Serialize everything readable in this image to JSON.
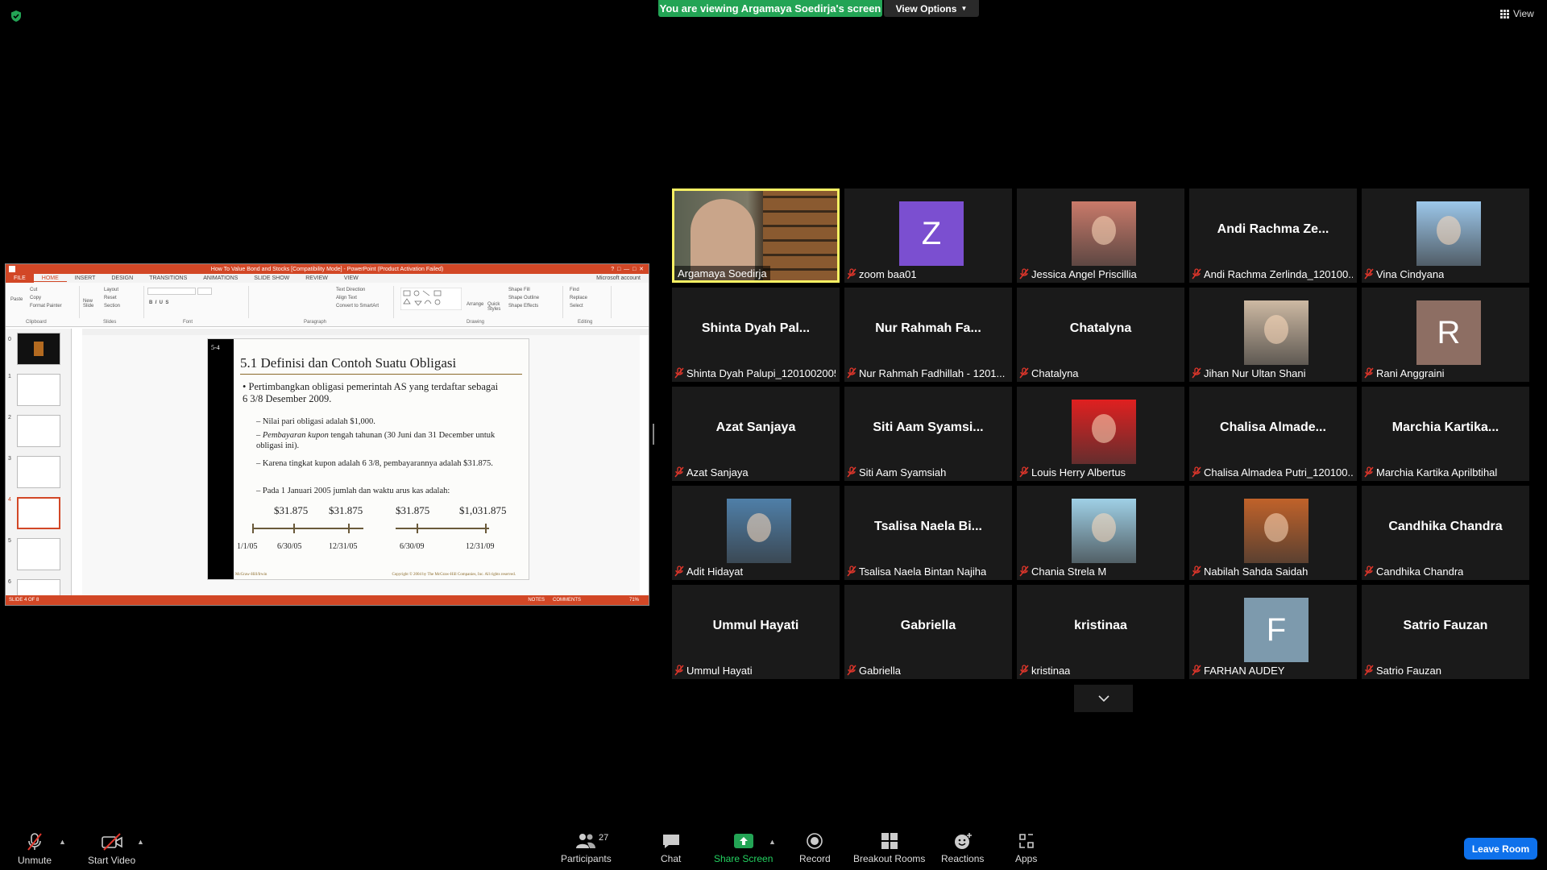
{
  "banner": {
    "viewing": "You are viewing Argamaya Soedirja's screen",
    "view_options": "View Options"
  },
  "top_right": {
    "view": "View"
  },
  "powerpoint": {
    "title": "How To Value Bond and Stocks [Compatibility Mode] - PowerPoint (Product Activation Failed)",
    "tabs": [
      "FILE",
      "HOME",
      "INSERT",
      "DESIGN",
      "TRANSITIONS",
      "ANIMATIONS",
      "SLIDE SHOW",
      "REVIEW",
      "VIEW"
    ],
    "account": "Microsoft account",
    "ribbon_groups": [
      "Clipboard",
      "Slides",
      "Font",
      "Paragraph",
      "Drawing",
      "Editing"
    ],
    "ribbon_items": {
      "paste": "Paste",
      "cut": "Cut",
      "copy": "Copy",
      "format_painter": "Format Painter",
      "new_slide": "New Slide",
      "layout": "Layout",
      "reset": "Reset",
      "section": "Section",
      "text_direction": "Text Direction",
      "align_text": "Align Text",
      "smartart": "Convert to SmartArt",
      "arrange": "Arrange",
      "quick_styles": "Quick Styles",
      "shape_fill": "Shape Fill",
      "shape_outline": "Shape Outline",
      "shape_effects": "Shape Effects",
      "find": "Find",
      "replace": "Replace",
      "select": "Select"
    },
    "thumbs": [
      "0",
      "1",
      "2",
      "3",
      "4",
      "5",
      "6"
    ],
    "slide": {
      "number": "5-4",
      "title": "5.1   Definisi dan Contoh Suatu Obligasi",
      "bullet": "Pertimbangkan obligasi pemerintah AS yang terdaftar sebagai 6 3/8 Desember 2009.",
      "sub1": "Nilai pari obligasi adalah $1,000.",
      "sub2_italic": "Pembayaran kupon",
      "sub2_rest": " tengah tahunan (30 Juni dan 31 December untuk obligasi ini).",
      "sub3": "Karena tingkat kupon adalah 6 3/8, pembayarannya adalah $31.875.",
      "sub4": "Pada 1 Januari 2005 jumlah dan waktu arus kas adalah:",
      "amounts": [
        "$31.875",
        "$31.875",
        "$31.875",
        "$1,031.875"
      ],
      "dates": [
        "1/1/05",
        "6/30/05",
        "12/31/05",
        "6/30/09",
        "12/31/09"
      ],
      "footer_left": "McGraw-Hill/Irwin",
      "footer_right": "Copyright © 2004 by The McGraw-Hill Companies, Inc. All rights reserved."
    },
    "status": {
      "slide": "SLIDE 4 OF 8",
      "notes": "NOTES",
      "comments": "COMMENTS",
      "zoom": "71%"
    }
  },
  "participants": [
    {
      "name": "Argamaya Soedirja",
      "label": "Argamaya Soedirja",
      "type": "video",
      "active": true
    },
    {
      "name": "zoom baa01",
      "label": "zoom baa01",
      "type": "letter",
      "letter": "Z",
      "color": "#7b4fd0"
    },
    {
      "name": "Jessica Angel Priscillia",
      "label": "Jessica Angel Priscillia",
      "type": "photo",
      "color": "#c97a6a"
    },
    {
      "name": "Andi Rachma Ze...",
      "label": "Andi Rachma Zerlinda_120100...",
      "type": "name"
    },
    {
      "name": "Vina Cindyana",
      "label": "Vina Cindyana",
      "type": "photo",
      "color": "#9cc7ea"
    },
    {
      "name": "Shinta Dyah Pal...",
      "label": "Shinta Dyah Palupi_1201002005",
      "type": "name"
    },
    {
      "name": "Nur Rahmah Fa...",
      "label": "Nur Rahmah Fadhillah - 1201...",
      "type": "name"
    },
    {
      "name": "Chatalyna",
      "label": "Chatalyna",
      "type": "name"
    },
    {
      "name": "Jihan Nur Ultan Shani",
      "label": "Jihan Nur Ultan Shani",
      "type": "photo",
      "color": "#cdb9a3"
    },
    {
      "name": "Rani Anggraini",
      "label": "Rani Anggraini",
      "type": "letter",
      "letter": "R",
      "color": "#8d6e63"
    },
    {
      "name": "Azat Sanjaya",
      "label": "Azat Sanjaya",
      "type": "name"
    },
    {
      "name": "Siti Aam Syamsi...",
      "label": "Siti Aam Syamsiah",
      "type": "name"
    },
    {
      "name": "Louis Herry Albertus",
      "label": "Louis Herry Albertus",
      "type": "photo",
      "color": "#e02020"
    },
    {
      "name": "Chalisa Almade...",
      "label": "Chalisa Almadea Putri_120100...",
      "type": "name"
    },
    {
      "name": "Marchia Kartika...",
      "label": "Marchia Kartika Aprilbtihal",
      "type": "name"
    },
    {
      "name": "Adit Hidayat",
      "label": "Adit Hidayat",
      "type": "photo",
      "color": "#4f7fa8"
    },
    {
      "name": "Tsalisa Naela Bi...",
      "label": "Tsalisa Naela Bintan Najiha",
      "type": "name"
    },
    {
      "name": "Chania Strela M",
      "label": "Chania Strela M",
      "type": "photo",
      "color": "#9fd0e6"
    },
    {
      "name": "Nabilah Sahda Saidah",
      "label": "Nabilah Sahda Saidah",
      "type": "photo",
      "color": "#c0622a"
    },
    {
      "name": "Candhika Chandra",
      "label": "Candhika Chandra",
      "type": "name"
    },
    {
      "name": "Ummul Hayati",
      "label": "Ummul Hayati",
      "type": "name"
    },
    {
      "name": "Gabriella",
      "label": "Gabriella",
      "type": "name"
    },
    {
      "name": "kristinaa",
      "label": "kristinaa",
      "type": "name"
    },
    {
      "name": "FARHAN AUDEY",
      "label": "FARHAN AUDEY",
      "type": "letter",
      "letter": "F",
      "color": "#7d9aad"
    },
    {
      "name": "Satrio Fauzan",
      "label": "Satrio Fauzan",
      "type": "name"
    }
  ],
  "toolbar": {
    "unmute": "Unmute",
    "start_video": "Start Video",
    "participants": "Participants",
    "participant_count": "27",
    "chat": "Chat",
    "share_screen": "Share Screen",
    "record": "Record",
    "breakout": "Breakout Rooms",
    "reactions": "Reactions",
    "apps": "Apps",
    "leave": "Leave Room"
  },
  "colors": {
    "accent_green": "#23a455",
    "leave_blue": "#0e71eb",
    "active_speaker": "#f7f063",
    "muted_red": "#e0362b",
    "powerpoint": "#d24726"
  }
}
